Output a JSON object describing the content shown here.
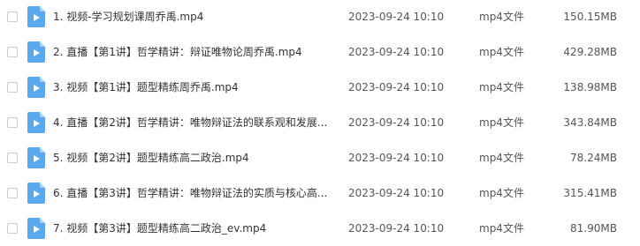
{
  "colors": {
    "icon_bg": "#5aa9f0",
    "icon_fold": "#a9d2f7",
    "checkbox_border": "#c9ccd2",
    "text": "#333333"
  },
  "files": [
    {
      "name": "1. 视频-学习规划课周乔禹.mp4",
      "date": "2023-09-24 10:10",
      "type": "mp4文件",
      "size": "150.15MB"
    },
    {
      "name": "2. 直播【第1讲】哲学精讲：辩证唯物论周乔禹.mp4",
      "date": "2023-09-24 10:10",
      "type": "mp4文件",
      "size": "429.28MB"
    },
    {
      "name": "3. 视频【第1讲】题型精练周乔禹.mp4",
      "date": "2023-09-24 10:10",
      "type": "mp4文件",
      "size": "138.98MB"
    },
    {
      "name": "4. 直播【第2讲】哲学精讲：唯物辩证法的联系观和发展...",
      "date": "2023-09-24 10:10",
      "type": "mp4文件",
      "size": "343.84MB"
    },
    {
      "name": "5. 视频【第2讲】题型精练高二政治.mp4",
      "date": "2023-09-24 10:10",
      "type": "mp4文件",
      "size": "78.24MB"
    },
    {
      "name": "6. 直播【第3讲】哲学精讲：唯物辩证法的实质与核心高...",
      "date": "2023-09-24 10:10",
      "type": "mp4文件",
      "size": "315.41MB"
    },
    {
      "name": "7. 视频【第3讲】题型精练高二政治_ev.mp4",
      "date": "2023-09-24 10:10",
      "type": "mp4文件",
      "size": "81.90MB"
    }
  ]
}
